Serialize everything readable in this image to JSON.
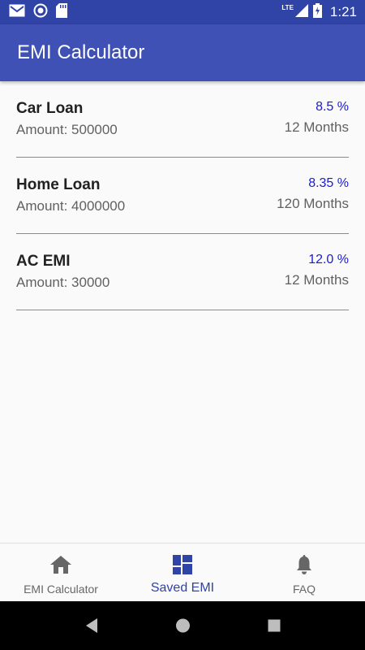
{
  "status_bar": {
    "time": "1:21",
    "network": "LTE",
    "icons": [
      "gmail-icon",
      "sync-icon",
      "sd-card-icon",
      "signal-icon",
      "battery-icon"
    ]
  },
  "app_bar": {
    "title": "EMI Calculator"
  },
  "loans": [
    {
      "name": "Car Loan",
      "amount": "Amount: 500000",
      "rate": "8.5 %",
      "term": "12 Months"
    },
    {
      "name": "Home Loan",
      "amount": "Amount: 4000000",
      "rate": "8.35 %",
      "term": "120 Months"
    },
    {
      "name": "AC EMI",
      "amount": "Amount: 30000",
      "rate": "12.0 %",
      "term": "12 Months"
    }
  ],
  "bottom_nav": {
    "items": [
      {
        "label": "EMI Calculator",
        "icon": "home-icon",
        "active": false
      },
      {
        "label": "Saved EMI",
        "icon": "dashboard-icon",
        "active": true
      },
      {
        "label": "FAQ",
        "icon": "bell-icon",
        "active": false
      }
    ]
  },
  "colors": {
    "status_bar": "#3043a6",
    "app_bar": "#3f51b5",
    "rate_text": "#1a1ad6",
    "active_nav": "#3043a6"
  }
}
